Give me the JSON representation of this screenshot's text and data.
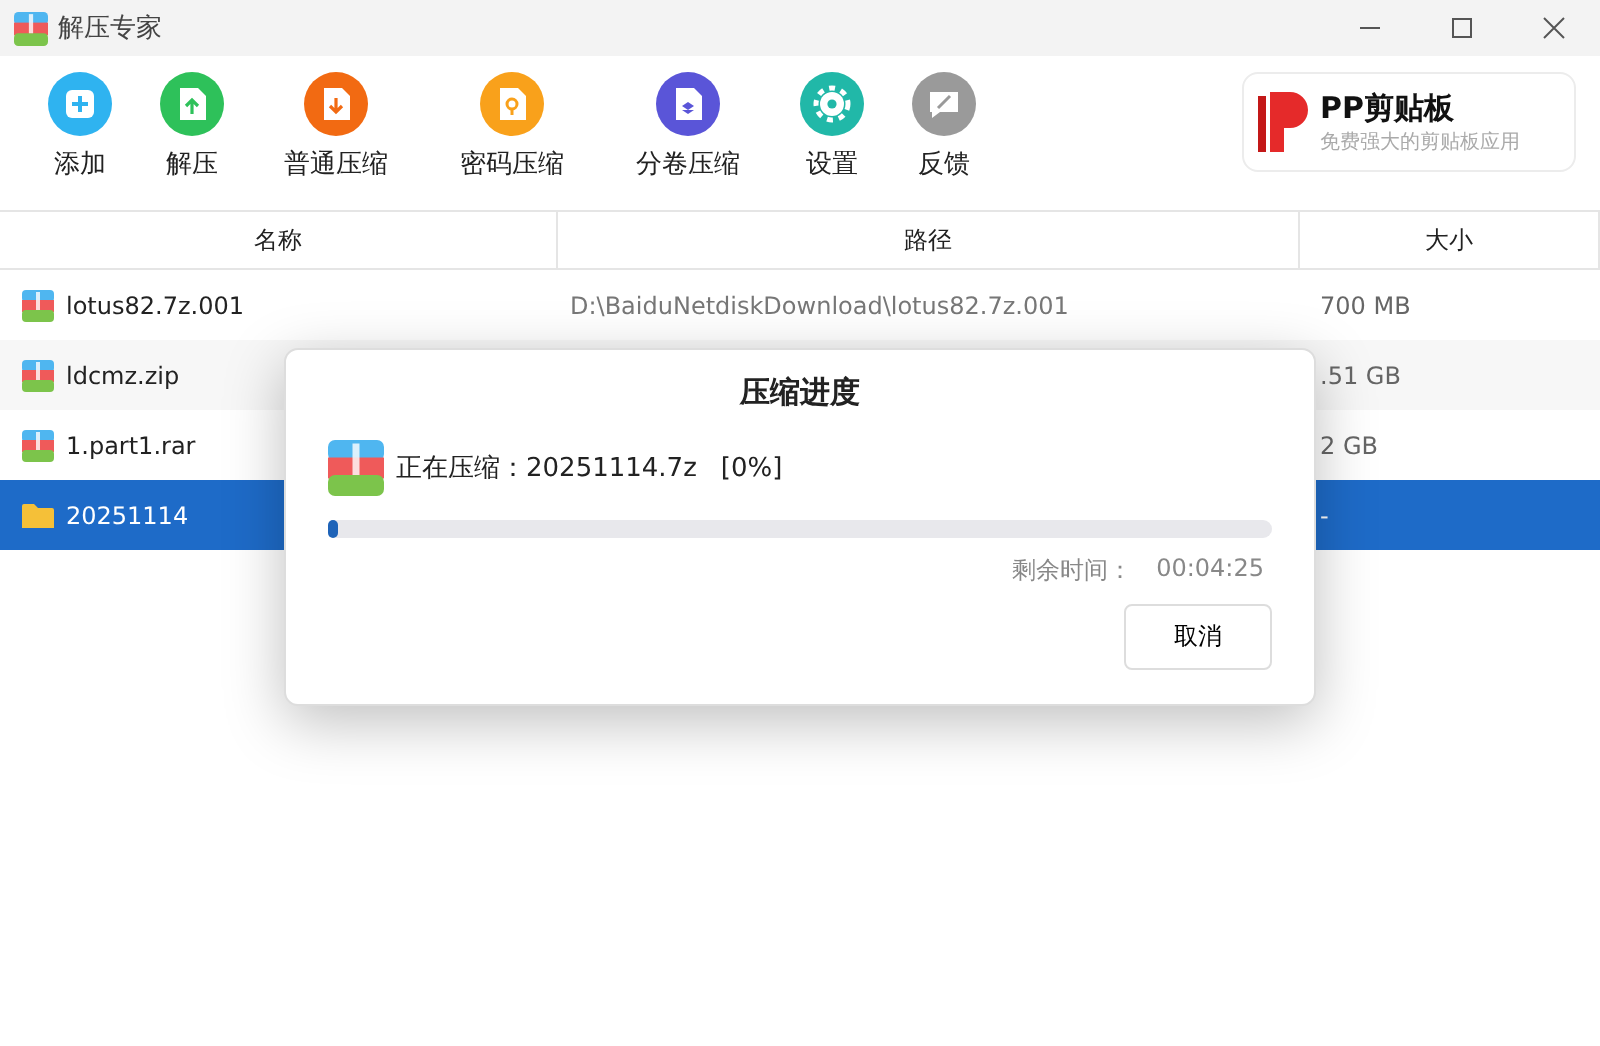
{
  "window": {
    "title": "解压专家"
  },
  "toolbar": [
    {
      "kind": "add",
      "label": "添加",
      "color": "#2fb3f0"
    },
    {
      "kind": "extract",
      "label": "解压",
      "color": "#2ec15a"
    },
    {
      "kind": "compress",
      "label": "普通压缩",
      "color": "#f26a12"
    },
    {
      "kind": "password",
      "label": "密码压缩",
      "color": "#f9a11b"
    },
    {
      "kind": "split",
      "label": "分卷压缩",
      "color": "#5a55d8"
    },
    {
      "kind": "settings",
      "label": "设置",
      "color": "#21b8a8"
    },
    {
      "kind": "feedback",
      "label": "反馈",
      "color": "#9a9a9a"
    }
  ],
  "ad": {
    "title": "PP剪贴板",
    "subtitle": "免费强大的剪贴板应用"
  },
  "table": {
    "columns": [
      "名称",
      "路径",
      "大小"
    ],
    "rows": [
      {
        "kind": "archive",
        "name": "lotus82.7z.001",
        "path": "D:\\BaiduNetdiskDownload\\lotus82.7z.001",
        "size": "700 MB",
        "selected": false
      },
      {
        "kind": "archive",
        "name": "ldcmz.zip",
        "size": ".51 GB",
        "selected": false
      },
      {
        "kind": "archive",
        "name": "1.part1.rar",
        "size": "2 GB",
        "selected": false
      },
      {
        "kind": "folder",
        "name": "20251114",
        "size": "-",
        "selected": true
      }
    ]
  },
  "dialog": {
    "title": "压缩进度",
    "status": "正在压缩：20251114.7z",
    "percent": "[0%]",
    "level": 0.01,
    "remaining_label": "剩余时间：",
    "remaining": "00:04:25",
    "button": "取消"
  }
}
